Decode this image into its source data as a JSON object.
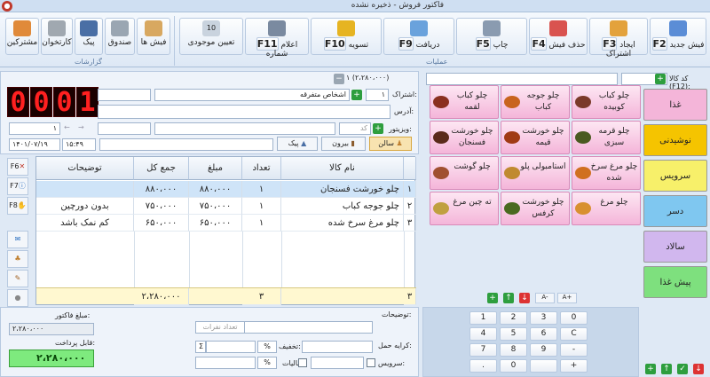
{
  "window": {
    "title": "فاکتور فروش - ذخیره نشده",
    "close": "●"
  },
  "ribbon": {
    "f2": {
      "key": "F2",
      "label": "فیش جدید"
    },
    "f3": {
      "key": "F3",
      "label": "ایجاد اشتراک"
    },
    "f4": {
      "key": "F4",
      "label": "حذف فیش"
    },
    "f5": {
      "key": "F5",
      "label": "چاپ"
    },
    "f9": {
      "key": "F9",
      "label": "دریافت"
    },
    "f10": {
      "key": "F10",
      "label": "تسویه"
    },
    "f11": {
      "key": "F11",
      "label": "اعلام شماره"
    },
    "stock": {
      "key": "10",
      "label": "تعیین موجودی"
    },
    "receipts": {
      "label": "فیش ها"
    },
    "cashbox": {
      "label": "صندوق"
    },
    "courier": {
      "label": "پیک"
    },
    "cashier": {
      "label": "کارتخوان"
    },
    "customers": {
      "label": "مشترکین"
    },
    "group_ops": "عملیات",
    "group_reports": "گزارشات"
  },
  "product_code": {
    "label": "کد کالا (F12):",
    "value": ""
  },
  "customer": {
    "number_label": "۱",
    "total": "(۲،۲۸۰،۰۰۰)",
    "subscriber_label": "اشتراک:",
    "subscriber_no": "۱",
    "subscriber_name": "اشخاص متفرقه",
    "address_label": "آدرس:",
    "visitor_label": "ویزیتور:",
    "code_ph": "کد",
    "counter": "۱",
    "date": "۱۴۰۱/۰۷/۱۹",
    "time": "۱۵:۴۹"
  },
  "order_number": [
    "0",
    "0",
    "0",
    "1"
  ],
  "service_type": {
    "salon": "سالن",
    "out": "بیرون",
    "courier": "پیک"
  },
  "table": {
    "headers": {
      "title": "توضیحات",
      "sum": "جمع کل",
      "price": "مبلغ",
      "qty": "تعداد",
      "name": "نام کالا"
    },
    "rows": [
      {
        "idx": "۱",
        "name": "چلو خورشت فسنجان",
        "qty": "۱",
        "price": "۸۸۰،۰۰۰",
        "sum": "۸۸۰،۰۰۰",
        "desc": ""
      },
      {
        "idx": "۲",
        "name": "چلو جوجه کباب",
        "qty": "۱",
        "price": "۷۵۰،۰۰۰",
        "sum": "۷۵۰،۰۰۰",
        "desc": "بدون دورچین"
      },
      {
        "idx": "۳",
        "name": "چلو مرغ سرخ شده",
        "qty": "۱",
        "price": "۶۵۰،۰۰۰",
        "sum": "۶۵۰،۰۰۰",
        "desc": "کم نمک باشد"
      }
    ],
    "footer": {
      "idx": "۳",
      "qty": "۳",
      "sum": "۲،۲۸۰،۰۰۰"
    }
  },
  "side_keys": {
    "f6": "F6",
    "f7": "F7",
    "f8": "F8"
  },
  "foods": [
    {
      "label": "چلو کباب کوبیده",
      "color": "#7a3a2a"
    },
    {
      "label": "چلو جوجه کباب",
      "color": "#c8641e"
    },
    {
      "label": "چلو کباب لقمه",
      "color": "#8a3020"
    },
    {
      "label": "چلو قرمه سبزی",
      "color": "#4a5a20"
    },
    {
      "label": "چلو خورشت قیمه",
      "color": "#a03a14"
    },
    {
      "label": "چلو خورشت فسنجان",
      "color": "#5a2a1a"
    },
    {
      "label": "چلو مرغ سرخ شده",
      "color": "#d07020"
    },
    {
      "label": "استامبولی پلو",
      "color": "#c08a30"
    },
    {
      "label": "چلو گوشت",
      "color": "#a05030"
    },
    {
      "label": "چلو مرغ",
      "color": "#d89030"
    },
    {
      "label": "چلو خورشت کرفس",
      "color": "#4a6a20"
    },
    {
      "label": "ته چین مرغ",
      "color": "#c0a040"
    }
  ],
  "categories": [
    {
      "label": "غذا",
      "color": "#f4b5d9"
    },
    {
      "label": "نوشیدنی",
      "color": "#f5c400"
    },
    {
      "label": "سرویس",
      "color": "#f7f06a"
    },
    {
      "label": "دسر",
      "color": "#7fc7f0"
    },
    {
      "label": "سالاد",
      "color": "#d1b7ee"
    },
    {
      "label": "پیش غذا",
      "color": "#7ee07e"
    }
  ],
  "font_ctrl": {
    "a_minus": "A-",
    "a_plus": "A+"
  },
  "summary": {
    "desc_label": "توضیحات:",
    "invoice_label": "مبلغ فاکتور:",
    "invoice_value": "۲،۲۸۰،۰۰۰",
    "payable_label": "قابل پرداخت:",
    "payable_value": "۲،۲۸۰،۰۰۰",
    "people_ph": "تعداد نفرات",
    "shipping_label": "کرایه حمل:",
    "discount_label": "تخفیف:",
    "tax_label": "مالیات:",
    "service_label": "سرویس:",
    "pct": "%",
    "sigma": "Σ"
  },
  "keypad": [
    "1",
    "2",
    "3",
    "0",
    "4",
    "5",
    "6",
    "C",
    "7",
    "8",
    "9",
    "-",
    ".",
    "0",
    "",
    "+"
  ]
}
